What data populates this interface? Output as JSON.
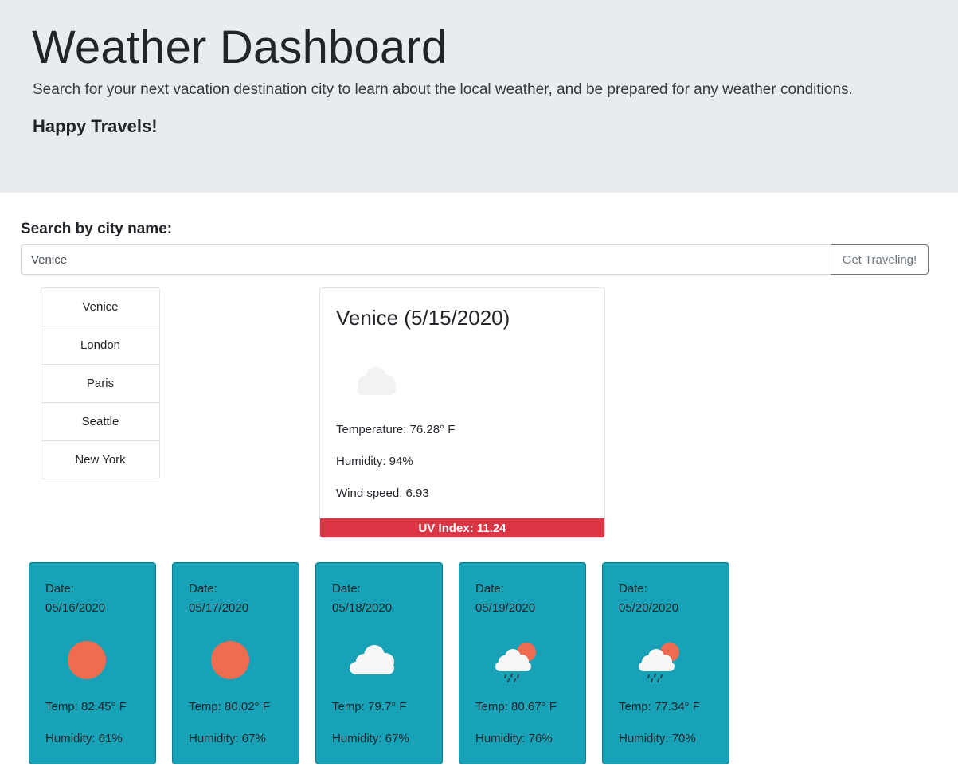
{
  "header": {
    "title": "Weather Dashboard",
    "lead": "Search for your next vacation destination city to learn about the local weather, and be prepared for any weather conditions.",
    "tagline": "Happy Travels!"
  },
  "search": {
    "label": "Search by city name:",
    "value": "Venice",
    "button_label": "Get Traveling!"
  },
  "history": [
    "Venice",
    "London",
    "Paris",
    "Seattle",
    "New York"
  ],
  "current": {
    "title": "Venice (5/15/2020)",
    "icon": "cloud-icon",
    "temperature": "Temperature: 76.28° F",
    "humidity": "Humidity: 94%",
    "wind": "Wind speed: 6.93",
    "uv": "UV Index: 11.24",
    "uv_color": "#dc3545"
  },
  "forecast": [
    {
      "label": "Date:",
      "date": "05/16/2020",
      "icon": "sun-icon",
      "temp": "Temp: 82.45° F",
      "humidity": "Humidity: 61%"
    },
    {
      "label": "Date:",
      "date": "05/17/2020",
      "icon": "sun-icon",
      "temp": "Temp: 80.02° F",
      "humidity": "Humidity: 67%"
    },
    {
      "label": "Date:",
      "date": "05/18/2020",
      "icon": "cloud-icon",
      "temp": "Temp: 79.7° F",
      "humidity": "Humidity: 67%"
    },
    {
      "label": "Date:",
      "date": "05/19/2020",
      "icon": "rain-sun-icon",
      "temp": "Temp: 80.67° F",
      "humidity": "Humidity: 76%"
    },
    {
      "label": "Date:",
      "date": "05/20/2020",
      "icon": "rain-sun-icon",
      "temp": "Temp: 77.34° F",
      "humidity": "Humidity: 70%"
    }
  ],
  "colors": {
    "header_bg": "#e9ecef",
    "forecast_bg": "#17a2b8",
    "sun": "#ef6c50",
    "cloud": "#f4f4f4"
  }
}
